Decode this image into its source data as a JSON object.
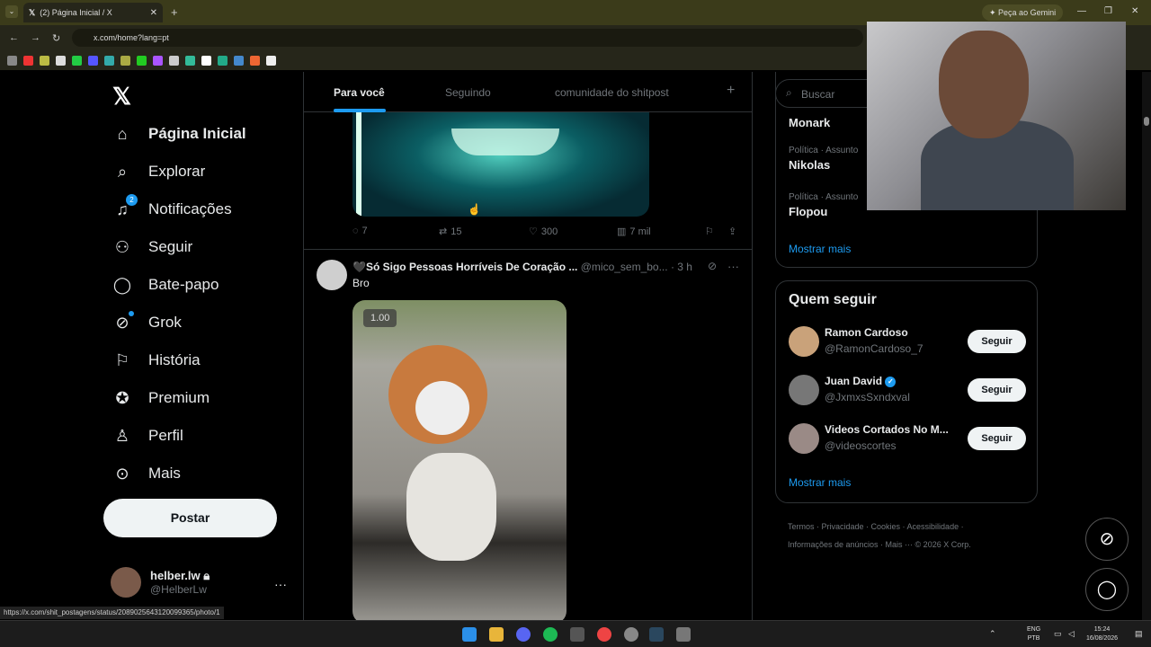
{
  "browser": {
    "tab_title": "(2) Página Inicial / X",
    "tab_close": "✕",
    "new_tab": "+",
    "url": "x.com/home?lang=pt",
    "gemini_button": "Peça ao Gemini",
    "status_url": "https://x.com/shit_postagens/status/2089025643120099365/photo/1"
  },
  "nav": {
    "items": [
      {
        "label": "Página Inicial",
        "icon": "home-icon"
      },
      {
        "label": "Explorar",
        "icon": "search-icon"
      },
      {
        "label": "Notificações",
        "icon": "bell-icon",
        "badge": "2"
      },
      {
        "label": "Seguir",
        "icon": "add-person-icon"
      },
      {
        "label": "Bate-papo",
        "icon": "chat-icon"
      },
      {
        "label": "Grok",
        "icon": "grok-icon"
      },
      {
        "label": "História",
        "icon": "bookmark-icon"
      },
      {
        "label": "Premium",
        "icon": "verified-icon"
      },
      {
        "label": "Perfil",
        "icon": "person-icon"
      },
      {
        "label": "Mais",
        "icon": "more-icon"
      }
    ],
    "post_button": "Postar",
    "profile_name": "helber.lw",
    "profile_handle": "@HelberLw",
    "profile_more": "···"
  },
  "feed": {
    "tabs": [
      "Para você",
      "Seguindo",
      "comunidade do shitpost"
    ],
    "tab_add": "+",
    "tweet1_actions": {
      "replies": "7",
      "retweets": "15",
      "likes": "300",
      "views": "7 mil"
    },
    "tweet2": {
      "name": "🖤Só Sigo Pessoas Horríveis De Coração ...",
      "handle": "@mico_sem_bo...",
      "time": "· 3 h",
      "text": "Bro",
      "more": "···",
      "speed": "1.00"
    }
  },
  "sidebar": {
    "search_placeholder": "Buscar",
    "trends": [
      {
        "category": "",
        "name": "Monark"
      },
      {
        "category": "Política · Assunto",
        "name": "Nikolas"
      },
      {
        "category": "Política · Assunto",
        "name": "Flopou"
      }
    ],
    "show_more": "Mostrar mais",
    "who_to_follow_title": "Quem seguir",
    "who_to_follow": [
      {
        "name": "Ramon Cardoso",
        "handle": "@RamonCardoso_7",
        "button": "Seguir"
      },
      {
        "name": "Juan David",
        "handle": "@JxmxsSxndxval",
        "button": "Seguir"
      },
      {
        "name": "Videos Cortados No M...",
        "handle": "@videoscortes",
        "button": "Seguir"
      }
    ],
    "show_more2": "Mostrar mais",
    "footer_line1": "Termos · Privacidade · Cookies · Acessibilidade ·",
    "footer_line2": "Informações de anúncios · Mais ··· © 2026 X Corp."
  },
  "taskbar": {
    "lang": "ENG",
    "lang2": "PTB",
    "time": "15:24",
    "date": "16/08/2026"
  }
}
